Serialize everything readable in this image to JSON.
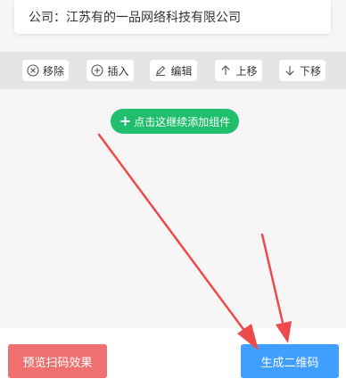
{
  "company": {
    "text": "公司：江苏有的一品网络科技有限公司"
  },
  "toolbar": {
    "remove_label": "移除",
    "insert_label": "插入",
    "edit_label": "编辑",
    "move_up_label": "上移",
    "move_down_label": "下移"
  },
  "canvas": {
    "add_component_label": "点击这继续添加组件"
  },
  "bottom": {
    "preview_label": "预览扫码效果",
    "generate_label": "生成二维码"
  },
  "colors": {
    "add_button": "#1fbf6e",
    "preview_button": "#f07070",
    "generate_button": "#409eff",
    "annotation_arrow": "#ee4a4a"
  }
}
